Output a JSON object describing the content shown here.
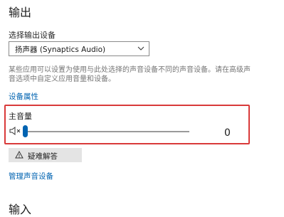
{
  "output_section": {
    "title": "输出",
    "choose_device_label": "选择输出设备",
    "device_select": {
      "selected": "扬声器 (Synaptics Audio)"
    },
    "description": "某些应用可以设置为使用与此处选择的声音设备不同的声音设备。请在高级声音选项中自定义应用音量和设备。",
    "device_properties_link": "设备属性",
    "master_volume": {
      "label": "主音量",
      "value": "0",
      "level_fraction": 0.0,
      "muted_icon": "speaker-muted-icon"
    },
    "troubleshoot_button": "疑难解答",
    "manage_devices_link": "管理声音设备"
  },
  "input_section": {
    "title": "输入"
  },
  "colors": {
    "accent": "#0063b1",
    "highlight_box": "#d93a3a",
    "description_text": "#767676",
    "button_bg": "#e4e4e4"
  }
}
